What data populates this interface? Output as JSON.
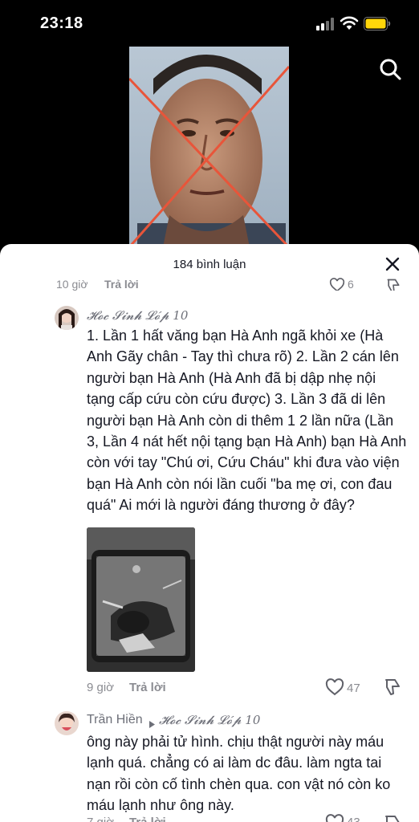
{
  "status_bar": {
    "time": "23:18"
  },
  "sheet": {
    "comment_count": "184 bình luận"
  },
  "previous_comment": {
    "time": "10 giờ",
    "reply_label": "Trả lời",
    "likes": "6"
  },
  "comments": [
    {
      "username": "𝓗𝓸𝓬 𝓢𝓲𝓷𝓱 𝓛𝓸́𝓹 10",
      "text": "1. Lần 1 hất văng bạn Hà Anh ngã khỏi xe (Hà Anh Gãy chân - Tay thì chưa rõ) 2. Lần 2 cán lên người bạn Hà Anh (Hà Anh đã bị dập nhẹ nội tạng cấp cứu còn cứu được) 3. Lần 3 đã di lên người bạn Hà Anh còn di thêm 1 2 lần nữa (Lần 3, Lần 4 nát hết nội tạng bạn Hà Anh) bạn Hà Anh còn với tay \"Chú ơi, Cứu Cháu\" khi đưa vào viện bạn Hà Anh còn nói lần cuối \"ba mẹ ơi, con đau quá\" Ai mới là người đáng thương ở đây?",
      "time": "9 giờ",
      "reply_label": "Trả lời",
      "likes": "47"
    },
    {
      "username": "Trần Hiền",
      "reply_to": "𝓗𝓸𝓬 𝓢𝓲𝓷𝓱 𝓛𝓸́𝓹 10",
      "text": "ông này phải tử hình. chịu thật người này máu lạnh quá. chẳng có ai làm dc đâu. làm ngta tai nạn rồi còn cố tình chèn qua. con vật nó còn ko máu lạnh như ông này.",
      "time": "7 giờ",
      "reply_label": "Trả lời",
      "likes": "43"
    }
  ],
  "colors": {
    "text_primary": "#161823",
    "text_secondary": "#8a8b91",
    "cross_mark": "#e8553a",
    "battery": "#ffd60a"
  }
}
